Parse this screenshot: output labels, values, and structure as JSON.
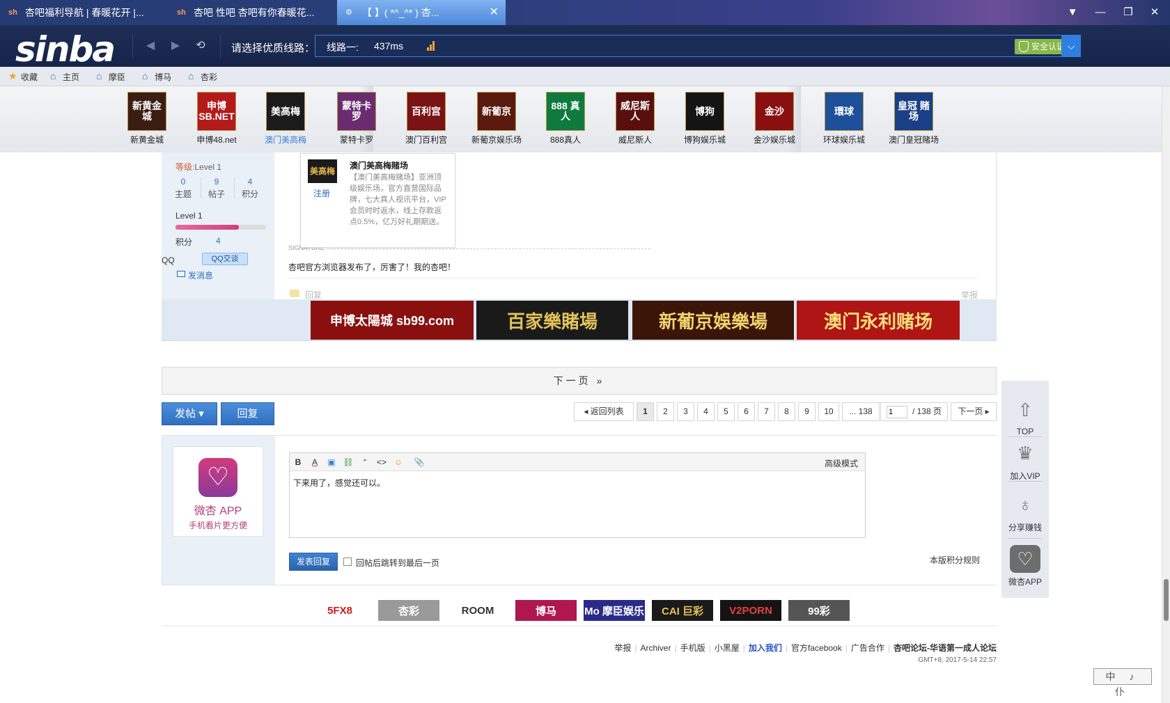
{
  "browser": {
    "tabs": [
      {
        "title": "杏吧福利导航 | 春暖花开 |..."
      },
      {
        "title": "杏吧 性吧 杏吧有你春暖花..."
      },
      {
        "title": "【        】( *^_^* ) 杏..."
      }
    ],
    "logo": "sinba",
    "line_prompt": "请选择优质线路：",
    "line_name": "线路一:",
    "line_ping": "437ms",
    "secure_label": "安全认证",
    "bookmarks": [
      {
        "label": "收藏",
        "icon": "star-icon"
      },
      {
        "label": "主页",
        "icon": "home-icon"
      },
      {
        "label": "摩臣",
        "icon": "home-icon"
      },
      {
        "label": "博马",
        "icon": "home-icon"
      },
      {
        "label": "杏彩",
        "icon": "home-icon"
      }
    ]
  },
  "casinos": [
    {
      "name": "新黄金城",
      "logo_text": "新黄金城",
      "color": "#3b1d12"
    },
    {
      "name": "申博48.net",
      "logo_text": "申博 SB.NET",
      "color": "#b31b1b"
    },
    {
      "name": "澳门美高梅",
      "logo_text": "美高梅",
      "color": "#1b1b1b"
    },
    {
      "name": "蒙特卡罗",
      "logo_text": "蒙特卡罗",
      "color": "#6a2c6e"
    },
    {
      "name": "澳门百利宫",
      "logo_text": "百利宫",
      "color": "#7a1313"
    },
    {
      "name": "新葡京娱乐场",
      "logo_text": "新葡京",
      "color": "#5a1a0e"
    },
    {
      "name": "888真人",
      "logo_text": "888 真人",
      "color": "#0f7a3e"
    },
    {
      "name": "威尼斯人",
      "logo_text": "威尼斯人",
      "color": "#5a0f0f"
    },
    {
      "name": "博狗娱乐城",
      "logo_text": "博狗",
      "color": "#141414"
    },
    {
      "name": "金沙娱乐城",
      "logo_text": "金沙",
      "color": "#8a1010"
    },
    {
      "name": "环球娱乐城",
      "logo_text": "環球",
      "color": "#1d4f9a"
    },
    {
      "name": "澳门皇冠赌场",
      "logo_text": "皇冠 赌场",
      "color": "#1b3f86"
    }
  ],
  "popup": {
    "logo_text": "美高梅",
    "register": "注册",
    "title": "澳门美高梅赌场",
    "desc": "【澳门美高梅赌场】亚洲顶级娱乐场，官方直营国际品牌，七大真人视讯平台，VIP会员时时返水，线上存款返点0.5%，亿万好礼期期送。"
  },
  "user": {
    "level_label": "等级:",
    "level_value": "Level 1",
    "stats": [
      {
        "num": "0",
        "name": "主题"
      },
      {
        "num": "9",
        "name": "帖子"
      },
      {
        "num": "4",
        "name": "积分"
      }
    ],
    "level_name": "Level 1",
    "level_progress": 0.7,
    "score_label": "积分",
    "score_value": "4",
    "qq_label": "QQ",
    "qq_button": "QQ交谈",
    "message_link": "发消息"
  },
  "post": {
    "signature_label": "SIGNATURE",
    "signature_text": "杏吧官方浏览器发布了，厉害了！我的杏吧！",
    "reply_label": "回复",
    "report_label": "举报"
  },
  "ads": [
    {
      "text": "申博太陽城 sb99.com",
      "bg": "#8a1010",
      "fg": "#ffffff"
    },
    {
      "text": "百家樂賭場",
      "bg": "#1a1a1a",
      "fg": "#e2c35a"
    },
    {
      "text": "新葡京娛樂場",
      "bg": "#3a1508",
      "fg": "#f2d26a"
    },
    {
      "text": "澳门永利赌场",
      "bg": "#b01515",
      "fg": "#f6df7a"
    }
  ],
  "next_page_bar": "下一页 »",
  "actions": {
    "post_button": "发帖 ▾",
    "reply_button": "回复"
  },
  "pagination": {
    "back": "◂ 返回列表",
    "pages": [
      "1",
      "2",
      "3",
      "4",
      "5",
      "6",
      "7",
      "8",
      "9",
      "10",
      "... 138"
    ],
    "current": "1",
    "input_value": "1",
    "total": "/ 138 页",
    "next": "下一页 ▸"
  },
  "reply_box": {
    "app_title": "微杏 APP",
    "app_sub": "手机看片更方便",
    "advanced_mode": "高级模式",
    "editor_text": "下来用了，感觉还可以。",
    "submit": "发表回复",
    "jump_label": "回帖后跳转到最后一页",
    "rules_link": "本版积分规则"
  },
  "side_tools": [
    {
      "label": "TOP",
      "icon": "arrow-up-icon"
    },
    {
      "label": "加入VIP",
      "icon": "crown-icon"
    },
    {
      "label": "分享赚钱",
      "icon": "money-bag-icon"
    },
    {
      "label": "微杏APP",
      "icon": "app-icon"
    }
  ],
  "footer_logos": [
    {
      "text": "5FX8",
      "bg": "#ffffff",
      "fg": "#d21a1a"
    },
    {
      "text": "杏彩",
      "bg": "#9a9a9a",
      "fg": "#ffffff"
    },
    {
      "text": "ROOM",
      "bg": "#ffffff",
      "fg": "#333333"
    },
    {
      "text": "博马",
      "bg": "#b0174f",
      "fg": "#ffffff"
    },
    {
      "text": "Mo 摩臣娱乐",
      "bg": "#2a2a8a",
      "fg": "#ffffff"
    },
    {
      "text": "CAI 巨彩",
      "bg": "#1a1a1a",
      "fg": "#e6c25a"
    },
    {
      "text": "V2PORN",
      "bg": "#141414",
      "fg": "#e64040"
    },
    {
      "text": "99彩",
      "bg": "#555555",
      "fg": "#ffffff"
    }
  ],
  "footer_links": [
    "举报",
    "Archiver",
    "手机版",
    "小黑屋",
    "加入我们",
    "官方facebook",
    "广告合作",
    "杏吧论坛-华语第一成人论坛"
  ],
  "footer_time": "GMT+8, 2017-5-14 22:57",
  "ime": "中 ♪ 仆"
}
